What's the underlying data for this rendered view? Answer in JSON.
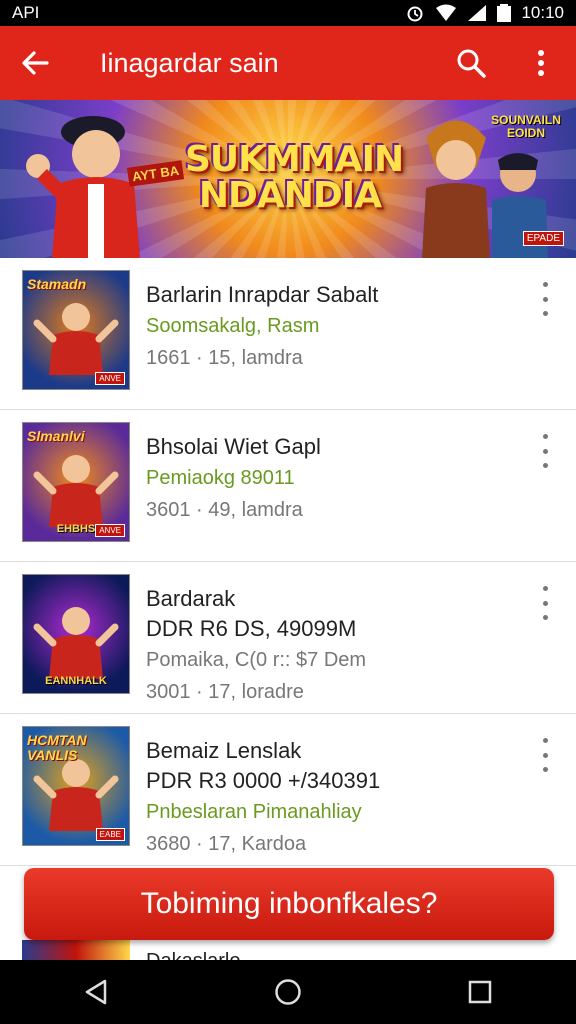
{
  "status_bar": {
    "left_text": "API",
    "time": "10:10"
  },
  "app_bar": {
    "title": "Iinagardar sain"
  },
  "banner": {
    "title_line1": "SUKMMAIN",
    "title_line2": "NDANDIA",
    "side_text": "SOUNVAILN EOIDN",
    "tag": "AYT BA",
    "badge": "EPADE"
  },
  "items": [
    {
      "thumb_title": "Stamadn",
      "thumb_badge": "ANVE",
      "thumb_colors": [
        "#1c3a8a",
        "#e07a1c"
      ],
      "lines": [
        {
          "text": "Barlarin Inrapdar Sabalt",
          "style": "title"
        },
        {
          "text": "Soomsakalg, Rasm",
          "style": "green"
        },
        {
          "text": "1661 · 15, lamdra",
          "style": "gray"
        }
      ]
    },
    {
      "thumb_title": "Slmanlvi",
      "thumb_foot": "EHBHS",
      "thumb_badge": "ANVE",
      "thumb_colors": [
        "#5a2a9a",
        "#f08a1c"
      ],
      "lines": [
        {
          "text": "Bhsolai Wiet Gapl",
          "style": "title"
        },
        {
          "text": "Pemiaokg 89011",
          "style": "green"
        },
        {
          "text": "3601 · 49, lamdra",
          "style": "gray"
        }
      ]
    },
    {
      "thumb_foot": "EANNHALK",
      "thumb_colors": [
        "#0d1a5a",
        "#b02ad0"
      ],
      "lines": [
        {
          "text": "Bardarak",
          "style": "title"
        },
        {
          "text": "DDR R6 DS, 49099M",
          "style": "title"
        },
        {
          "text": "Pomaika, C(0 r:: $7 Dem",
          "style": "gray"
        },
        {
          "text": "3001 · 17, loradre",
          "style": "gray"
        }
      ]
    },
    {
      "thumb_title": "HCMTAN VANLIS",
      "thumb_badge": "EABE",
      "thumb_colors": [
        "#1c5aa8",
        "#e0a01c"
      ],
      "lines": [
        {
          "text": "Bemaiz Lenslak",
          "style": "title"
        },
        {
          "text": "PDR R3 0000 +/340391",
          "style": "title"
        },
        {
          "text": "Pnbeslaran Pimanahliay",
          "style": "green"
        },
        {
          "text": "3680 · 17, Kardoa",
          "style": "gray"
        }
      ]
    }
  ],
  "cta": {
    "label": "Tobiming inbonfkales?"
  },
  "peek_item": {
    "text": "Dakaslarlo"
  },
  "colors": {
    "accent": "#e0261b",
    "green_text": "#6a9a1f"
  },
  "icons": {
    "back": "arrow-left-icon",
    "search": "search-icon",
    "more": "more-vert-icon",
    "nav_back": "triangle-back-icon",
    "nav_home": "circle-home-icon",
    "nav_recents": "square-recents-icon"
  }
}
